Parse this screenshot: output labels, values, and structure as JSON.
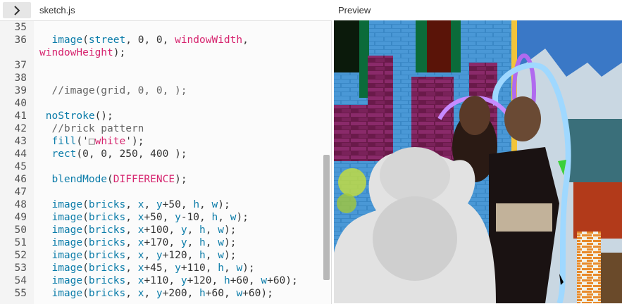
{
  "header": {
    "toggle_icon": "chevron-right-icon",
    "file_name": "sketch.js",
    "preview_label": "Preview"
  },
  "editor": {
    "lines": [
      {
        "num": "35",
        "tokens": []
      },
      {
        "num": "36",
        "tokens": [
          {
            "t": "  "
          },
          {
            "t": "image",
            "c": "fn"
          },
          {
            "t": "("
          },
          {
            "t": "street",
            "c": "fn"
          },
          {
            "t": ", 0, 0, "
          },
          {
            "t": "windowWidth",
            "c": "kw"
          },
          {
            "t": ","
          }
        ]
      },
      {
        "num": "",
        "tokens": [
          {
            "t": "windowHeight",
            "c": "kw"
          },
          {
            "t": ");"
          }
        ],
        "wrap": true
      },
      {
        "num": "37",
        "tokens": []
      },
      {
        "num": "38",
        "tokens": []
      },
      {
        "num": "39",
        "tokens": [
          {
            "t": "  //image(grid, 0, 0, );",
            "c": "cm"
          }
        ]
      },
      {
        "num": "40",
        "tokens": []
      },
      {
        "num": "41",
        "tokens": [
          {
            "t": " "
          },
          {
            "t": "noStroke",
            "c": "fn"
          },
          {
            "t": "();"
          }
        ]
      },
      {
        "num": "42",
        "tokens": [
          {
            "t": "  //brick pattern",
            "c": "cm"
          }
        ]
      },
      {
        "num": "43",
        "tokens": [
          {
            "t": "  "
          },
          {
            "t": "fill",
            "c": "fn"
          },
          {
            "t": "('"
          },
          {
            "t": "□",
            "c": "cm"
          },
          {
            "t": "white",
            "c": "kw"
          },
          {
            "t": "');"
          }
        ]
      },
      {
        "num": "44",
        "tokens": [
          {
            "t": "  "
          },
          {
            "t": "rect",
            "c": "fn"
          },
          {
            "t": "(0, 0, 250, 400 );"
          }
        ]
      },
      {
        "num": "45",
        "tokens": []
      },
      {
        "num": "46",
        "tokens": [
          {
            "t": "  "
          },
          {
            "t": "blendMode",
            "c": "fn"
          },
          {
            "t": "("
          },
          {
            "t": "DIFFERENCE",
            "c": "kw"
          },
          {
            "t": ");"
          }
        ]
      },
      {
        "num": "47",
        "tokens": []
      },
      {
        "num": "48",
        "tokens": [
          {
            "t": "  "
          },
          {
            "t": "image",
            "c": "fn"
          },
          {
            "t": "("
          },
          {
            "t": "bricks",
            "c": "fn"
          },
          {
            "t": ", "
          },
          {
            "t": "x",
            "c": "fn"
          },
          {
            "t": ", "
          },
          {
            "t": "y",
            "c": "fn"
          },
          {
            "t": "+50, "
          },
          {
            "t": "h",
            "c": "fn"
          },
          {
            "t": ", "
          },
          {
            "t": "w",
            "c": "fn"
          },
          {
            "t": ");"
          }
        ]
      },
      {
        "num": "49",
        "tokens": [
          {
            "t": "  "
          },
          {
            "t": "image",
            "c": "fn"
          },
          {
            "t": "("
          },
          {
            "t": "bricks",
            "c": "fn"
          },
          {
            "t": ", "
          },
          {
            "t": "x",
            "c": "fn"
          },
          {
            "t": "+50, "
          },
          {
            "t": "y",
            "c": "fn"
          },
          {
            "t": "-10, "
          },
          {
            "t": "h",
            "c": "fn"
          },
          {
            "t": ", "
          },
          {
            "t": "w",
            "c": "fn"
          },
          {
            "t": ");"
          }
        ]
      },
      {
        "num": "50",
        "tokens": [
          {
            "t": "  "
          },
          {
            "t": "image",
            "c": "fn"
          },
          {
            "t": "("
          },
          {
            "t": "bricks",
            "c": "fn"
          },
          {
            "t": ", "
          },
          {
            "t": "x",
            "c": "fn"
          },
          {
            "t": "+100, "
          },
          {
            "t": "y",
            "c": "fn"
          },
          {
            "t": ", "
          },
          {
            "t": "h",
            "c": "fn"
          },
          {
            "t": ", "
          },
          {
            "t": "w",
            "c": "fn"
          },
          {
            "t": ");"
          }
        ]
      },
      {
        "num": "51",
        "tokens": [
          {
            "t": "  "
          },
          {
            "t": "image",
            "c": "fn"
          },
          {
            "t": "("
          },
          {
            "t": "bricks",
            "c": "fn"
          },
          {
            "t": ", "
          },
          {
            "t": "x",
            "c": "fn"
          },
          {
            "t": "+170, "
          },
          {
            "t": "y",
            "c": "fn"
          },
          {
            "t": ", "
          },
          {
            "t": "h",
            "c": "fn"
          },
          {
            "t": ", "
          },
          {
            "t": "w",
            "c": "fn"
          },
          {
            "t": ");"
          }
        ]
      },
      {
        "num": "52",
        "tokens": [
          {
            "t": "  "
          },
          {
            "t": "image",
            "c": "fn"
          },
          {
            "t": "("
          },
          {
            "t": "bricks",
            "c": "fn"
          },
          {
            "t": ", "
          },
          {
            "t": "x",
            "c": "fn"
          },
          {
            "t": ", "
          },
          {
            "t": "y",
            "c": "fn"
          },
          {
            "t": "+120, "
          },
          {
            "t": "h",
            "c": "fn"
          },
          {
            "t": ", "
          },
          {
            "t": "w",
            "c": "fn"
          },
          {
            "t": ");"
          }
        ]
      },
      {
        "num": "53",
        "tokens": [
          {
            "t": "  "
          },
          {
            "t": "image",
            "c": "fn"
          },
          {
            "t": "("
          },
          {
            "t": "bricks",
            "c": "fn"
          },
          {
            "t": ", "
          },
          {
            "t": "x",
            "c": "fn"
          },
          {
            "t": "+45, "
          },
          {
            "t": "y",
            "c": "fn"
          },
          {
            "t": "+110, "
          },
          {
            "t": "h",
            "c": "fn"
          },
          {
            "t": ", "
          },
          {
            "t": "w",
            "c": "fn"
          },
          {
            "t": ");"
          }
        ]
      },
      {
        "num": "54",
        "tokens": [
          {
            "t": "  "
          },
          {
            "t": "image",
            "c": "fn"
          },
          {
            "t": "("
          },
          {
            "t": "bricks",
            "c": "fn"
          },
          {
            "t": ", "
          },
          {
            "t": "x",
            "c": "fn"
          },
          {
            "t": "+110, "
          },
          {
            "t": "y",
            "c": "fn"
          },
          {
            "t": "+120, "
          },
          {
            "t": "h",
            "c": "fn"
          },
          {
            "t": "+60, "
          },
          {
            "t": "w",
            "c": "fn"
          },
          {
            "t": "+60);"
          }
        ]
      },
      {
        "num": "55",
        "tokens": [
          {
            "t": "  "
          },
          {
            "t": "image",
            "c": "fn"
          },
          {
            "t": "("
          },
          {
            "t": "bricks",
            "c": "fn"
          },
          {
            "t": ", "
          },
          {
            "t": "x",
            "c": "fn"
          },
          {
            "t": ", "
          },
          {
            "t": "y",
            "c": "fn"
          },
          {
            "t": "+200, "
          },
          {
            "t": "h",
            "c": "fn"
          },
          {
            "t": "+60, "
          },
          {
            "t": "w",
            "c": "fn"
          },
          {
            "t": "+60);"
          }
        ]
      }
    ]
  },
  "colors": {
    "function": "#0b7ca9",
    "keyword": "#d6246e",
    "comment": "#666666",
    "brick_blue": "#3a88c6",
    "brick_purple": "#7a1f5c",
    "red_block": "#5a1408",
    "green_block": "#0b6b3a"
  }
}
